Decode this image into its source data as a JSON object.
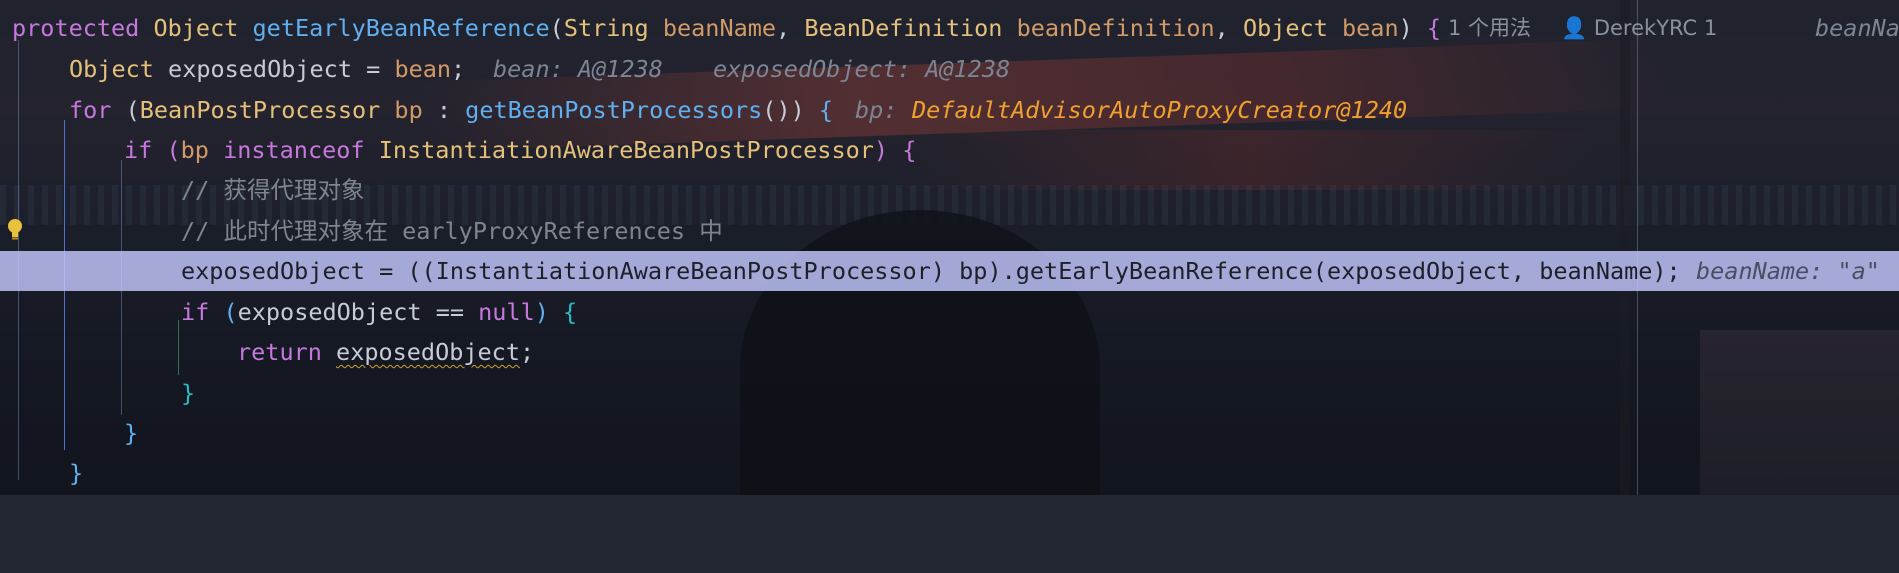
{
  "editor": {
    "lines": [
      {
        "tokens": [
          {
            "t": "protected ",
            "c": "kw"
          },
          {
            "t": "Object ",
            "c": "ty"
          },
          {
            "t": "getEarlyBeanReference",
            "c": "fn"
          },
          {
            "t": "(",
            "c": "pl"
          },
          {
            "t": "String ",
            "c": "ty"
          },
          {
            "t": "beanName",
            "c": "par"
          },
          {
            "t": ", ",
            "c": "pl"
          },
          {
            "t": "BeanDefinition ",
            "c": "ty"
          },
          {
            "t": "beanDefinition",
            "c": "par"
          },
          {
            "t": ", ",
            "c": "pl"
          },
          {
            "t": "Object ",
            "c": "ty"
          },
          {
            "t": "bean",
            "c": "par"
          },
          {
            "t": ") ",
            "c": "pl"
          },
          {
            "t": "{",
            "c": "br1"
          }
        ]
      },
      {
        "tokens": [
          {
            "t": "Object ",
            "c": "ty"
          },
          {
            "t": "exposedObject",
            "c": "pl"
          },
          {
            "t": " = ",
            "c": "pl"
          },
          {
            "t": "bean",
            "c": "par"
          },
          {
            "t": ";",
            "c": "pl"
          }
        ]
      },
      {
        "tokens": [
          {
            "t": "for ",
            "c": "kw"
          },
          {
            "t": "(",
            "c": "pl"
          },
          {
            "t": "BeanPostProcessor ",
            "c": "ty"
          },
          {
            "t": "bp",
            "c": "par"
          },
          {
            "t": " : ",
            "c": "pl"
          },
          {
            "t": "getBeanPostProcessors",
            "c": "fn"
          },
          {
            "t": "()) ",
            "c": "pl"
          },
          {
            "t": "{",
            "c": "br2"
          }
        ]
      },
      {
        "tokens": [
          {
            "t": "if ",
            "c": "kw"
          },
          {
            "t": "(",
            "c": "br1"
          },
          {
            "t": "bp ",
            "c": "par"
          },
          {
            "t": "instanceof ",
            "c": "kw"
          },
          {
            "t": "InstantiationAwareBeanPostProcessor",
            "c": "ty"
          },
          {
            "t": ") ",
            "c": "br1"
          },
          {
            "t": "{",
            "c": "br1"
          }
        ]
      },
      {
        "tokens": [
          {
            "t": "// 获得代理对象",
            "c": "cm"
          }
        ]
      },
      {
        "tokens": [
          {
            "t": "// 此时代理对象在 earlyProxyReferences 中",
            "c": "cm"
          }
        ]
      },
      {
        "tokens": [
          {
            "t": "exposedObject = ((InstantiationAwareBeanPostProcessor) bp).getEarlyBeanReference(exposedObject, beanName);",
            "c": "pl"
          }
        ]
      },
      {
        "tokens": [
          {
            "t": "if ",
            "c": "kw"
          },
          {
            "t": "(",
            "c": "br2"
          },
          {
            "t": "exposedObject",
            "c": "pl"
          },
          {
            "t": " == ",
            "c": "pl"
          },
          {
            "t": "null",
            "c": "kw"
          },
          {
            "t": ") ",
            "c": "br2"
          },
          {
            "t": "{",
            "c": "br3"
          }
        ]
      },
      {
        "tokens": [
          {
            "t": "return ",
            "c": "kw"
          },
          {
            "t": "exposedObject",
            "c": "pl warn"
          },
          {
            "t": ";",
            "c": "pl"
          }
        ]
      },
      {
        "tokens": [
          {
            "t": "}",
            "c": "br3"
          }
        ]
      },
      {
        "tokens": [
          {
            "t": "}",
            "c": "br2"
          }
        ]
      },
      {
        "tokens": [
          {
            "t": "}",
            "c": "br2"
          }
        ]
      }
    ],
    "inlay": {
      "usages": "1 个用法",
      "author": "DerekYRC 1",
      "header_hint": "beanNa",
      "line2_hint_bean": "bean: A@1238",
      "line2_hint_exposed": "exposedObject: A@1238",
      "line3_hint_label": "bp:",
      "line3_hint_value": "DefaultAdvisorAutoProxyCreator@1240",
      "line7_hint": "beanName: \"a\""
    }
  },
  "icons": {
    "person": "person-icon",
    "bulb": "lightbulb-icon"
  },
  "colors": {
    "keyword": "#c678dd",
    "type": "#e5c07b",
    "function": "#61afef",
    "parameter": "#d19a66",
    "comment": "#7f848e",
    "inlay_value": "#f0a030",
    "current_line": "#c4c8ff"
  }
}
